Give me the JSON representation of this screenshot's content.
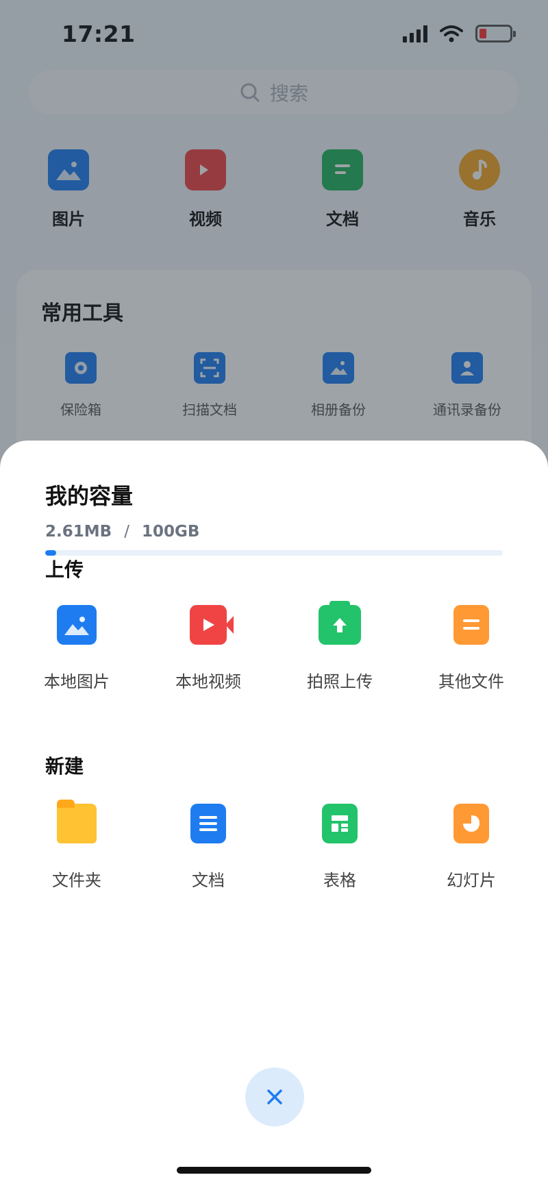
{
  "status_bar": {
    "time": "17:21"
  },
  "search": {
    "placeholder": "搜索"
  },
  "categories": [
    {
      "label": "图片",
      "icon": "image-icon",
      "color": "#1e7cf0"
    },
    {
      "label": "视频",
      "icon": "video-icon",
      "color": "#f04444"
    },
    {
      "label": "文档",
      "icon": "document-icon",
      "color": "#22b35e"
    },
    {
      "label": "音乐",
      "icon": "music-icon",
      "color": "#f5a623"
    }
  ],
  "tools": {
    "title": "常用工具",
    "items": [
      {
        "label": "保险箱",
        "icon": "safe-icon"
      },
      {
        "label": "扫描文档",
        "icon": "scan-icon"
      },
      {
        "label": "相册备份",
        "icon": "photo-backup-icon"
      },
      {
        "label": "通讯录备份",
        "icon": "contacts-backup-icon"
      }
    ]
  },
  "sheet": {
    "title": "我的容量",
    "capacity_used": "2.61MB",
    "capacity_separator": "/",
    "capacity_total": "100GB",
    "capacity_fraction": 2.61e-05,
    "upload": {
      "title": "上传",
      "items": [
        {
          "label": "本地图片",
          "icon": "image-icon",
          "color": "#1e7cf0"
        },
        {
          "label": "本地视频",
          "icon": "video-icon",
          "color": "#f04444"
        },
        {
          "label": "拍照上传",
          "icon": "camera-upload-icon",
          "color": "#22c36a"
        },
        {
          "label": "其他文件",
          "icon": "file-icon",
          "color": "#ff9933"
        }
      ]
    },
    "create": {
      "title": "新建",
      "items": [
        {
          "label": "文件夹",
          "icon": "folder-icon",
          "color": "#ffc233"
        },
        {
          "label": "文档",
          "icon": "document-icon",
          "color": "#1e7cf0"
        },
        {
          "label": "表格",
          "icon": "spreadsheet-icon",
          "color": "#22c36a"
        },
        {
          "label": "幻灯片",
          "icon": "slides-icon",
          "color": "#ff9933"
        }
      ]
    }
  },
  "colors": {
    "accent": "#1e7cf0",
    "close_bg": "#dcebfb"
  }
}
